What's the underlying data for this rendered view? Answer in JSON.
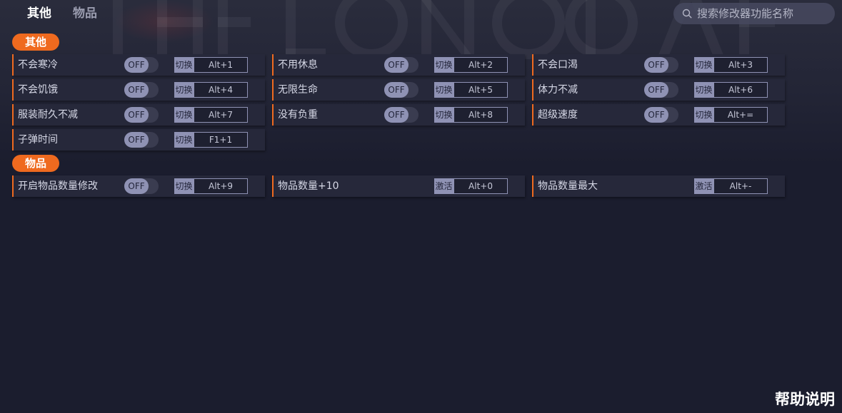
{
  "header": {
    "tabs": [
      {
        "label": "其他",
        "active": true
      },
      {
        "label": "物品",
        "active": false
      }
    ],
    "search": {
      "placeholder": "搜索修改器功能名称"
    }
  },
  "sections": {
    "other": {
      "title": "其他",
      "rows": [
        {
          "label": "不会寒冷",
          "toggle": "OFF",
          "mode": "切换",
          "hotkey": "Alt+1"
        },
        {
          "label": "不用休息",
          "toggle": "OFF",
          "mode": "切换",
          "hotkey": "Alt+2"
        },
        {
          "label": "不会口渴",
          "toggle": "OFF",
          "mode": "切换",
          "hotkey": "Alt+3"
        },
        {
          "label": "不会饥饿",
          "toggle": "OFF",
          "mode": "切换",
          "hotkey": "Alt+4"
        },
        {
          "label": "无限生命",
          "toggle": "OFF",
          "mode": "切换",
          "hotkey": "Alt+5"
        },
        {
          "label": "体力不减",
          "toggle": "OFF",
          "mode": "切换",
          "hotkey": "Alt+6"
        },
        {
          "label": "服装耐久不减",
          "toggle": "OFF",
          "mode": "切换",
          "hotkey": "Alt+7"
        },
        {
          "label": "没有负重",
          "toggle": "OFF",
          "mode": "切换",
          "hotkey": "Alt+8"
        },
        {
          "label": "超级速度",
          "toggle": "OFF",
          "mode": "切换",
          "hotkey": "Alt+="
        },
        {
          "label": "子弹时间",
          "toggle": "OFF",
          "mode": "切换",
          "hotkey": "F1+1"
        }
      ]
    },
    "items": {
      "title": "物品",
      "rows": [
        {
          "label": "开启物品数量修改",
          "toggle": "OFF",
          "mode": "切换",
          "hotkey": "Alt+9"
        },
        {
          "label": "物品数量+10",
          "mode": "激活",
          "hotkey": "Alt+0"
        },
        {
          "label": "物品数量最大",
          "mode": "激活",
          "hotkey": "Alt+-"
        }
      ]
    }
  },
  "footer": {
    "help_label": "帮助说明"
  },
  "colors": {
    "background": "#1b1d2e",
    "row_background": "#26283a",
    "accent": "#ef6a1f",
    "toggle_knob": "#8f92b4"
  }
}
